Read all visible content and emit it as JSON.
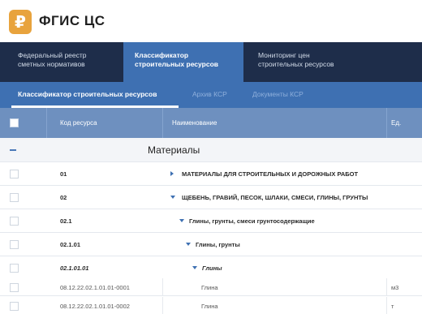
{
  "header": {
    "logo_glyph": "₽",
    "title": "ФГИС ЦС"
  },
  "topnav": {
    "items": [
      {
        "line1": "Федеральный реестр",
        "line2": "сметных нормативов"
      },
      {
        "line1": "Классификатор",
        "line2": "строительных ресурсов"
      },
      {
        "line1": "Мониторинг цен",
        "line2": "строительных ресурсов"
      }
    ],
    "active_index": 1
  },
  "subnav": {
    "items": [
      "Классификатор строительных ресурсов",
      "Архив КСР",
      "Документы КСР"
    ],
    "active_index": 0
  },
  "table": {
    "columns": {
      "code": "Код ресурса",
      "name": "Наименование",
      "unit": "Ед. измерения"
    },
    "section": "Материалы",
    "group_rows": [
      {
        "code": "01",
        "name": "МАТЕРИАЛЫ ДЛЯ СТРОИТЕЛЬНЫХ И ДОРОЖНЫХ РАБОТ"
      },
      {
        "code": "02",
        "name": "ЩЕБЕНЬ, ГРАВИЙ, ПЕСОК, ШЛАКИ, СМЕСИ, ГЛИНЫ, ГРУНТЫ"
      },
      {
        "code": "02.1",
        "name": "Глины, грунты, смеси грунтосодержащие"
      },
      {
        "code": "02.1.01",
        "name": "Глины, грунты"
      },
      {
        "code": "02.1.01.01",
        "name": "Глины"
      }
    ],
    "item_rows": [
      {
        "code": "08.12.22.02.1.01.01-0001",
        "name": "Глина",
        "unit": "м3"
      },
      {
        "code": "08.12.22.02.1.01.01-0002",
        "name": "Глина",
        "unit": "т"
      }
    ]
  },
  "colors": {
    "nav_dark": "#1e2d4a",
    "nav_active": "#3e70b2",
    "table_header": "#6e90bf",
    "logo": "#e8a33d"
  }
}
